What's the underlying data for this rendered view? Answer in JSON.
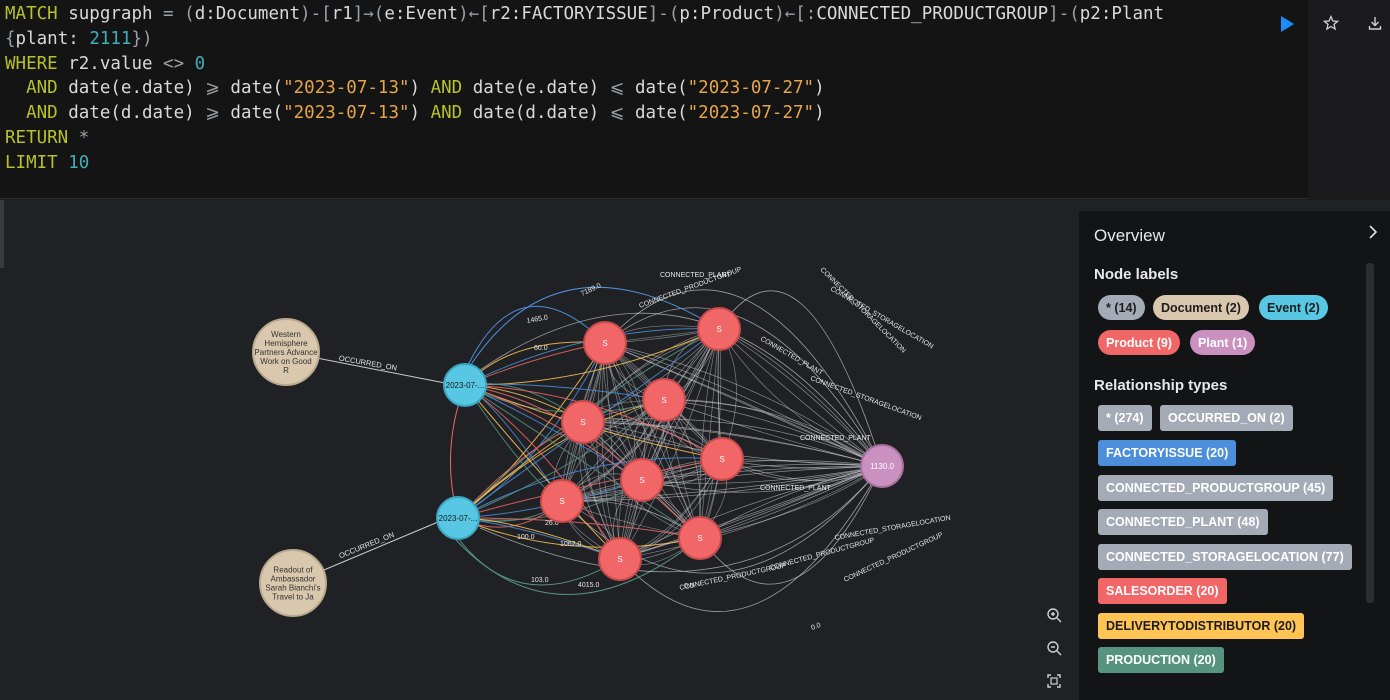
{
  "editor": {
    "lines": [
      [
        [
          "kw",
          "MATCH"
        ],
        [
          "t",
          " supgraph "
        ],
        [
          "op",
          "="
        ],
        [
          "t",
          " "
        ],
        [
          "op",
          "("
        ],
        [
          "t",
          "d:Document"
        ],
        [
          "op",
          ")-["
        ],
        [
          "t",
          "r1"
        ],
        [
          "op",
          "]→("
        ],
        [
          "t",
          "e:Event"
        ],
        [
          "op",
          ")←["
        ],
        [
          "t",
          "r2:FACTORYISSUE"
        ],
        [
          "op",
          "]-("
        ],
        [
          "t",
          "p:Product"
        ],
        [
          "op",
          ")←[:"
        ],
        [
          "t",
          "CONNECTED_PRODUCTGROUP"
        ],
        [
          "op",
          "]-("
        ],
        [
          "t",
          "p2:Plant"
        ]
      ],
      [
        [
          "op",
          "{"
        ],
        [
          "t",
          "plant: "
        ],
        [
          "num",
          "2111"
        ],
        [
          "op",
          "})"
        ]
      ],
      [
        [
          "kw",
          "WHERE"
        ],
        [
          "t",
          " r2.value "
        ],
        [
          "op",
          "<>"
        ],
        [
          "t",
          " "
        ],
        [
          "num",
          "0"
        ]
      ],
      [
        [
          "t",
          "  "
        ],
        [
          "kw",
          "AND"
        ],
        [
          "t",
          " date(e.date) "
        ],
        [
          "op",
          "⩾"
        ],
        [
          "t",
          " date("
        ],
        [
          "str",
          "\"2023-07-13\""
        ],
        [
          "t",
          ") "
        ],
        [
          "kw",
          "AND"
        ],
        [
          "t",
          " date(e.date) "
        ],
        [
          "op",
          "⩽"
        ],
        [
          "t",
          " date("
        ],
        [
          "str",
          "\"2023-07-27\""
        ],
        [
          "t",
          ")"
        ]
      ],
      [
        [
          "t",
          "  "
        ],
        [
          "kw",
          "AND"
        ],
        [
          "t",
          " date(d.date) "
        ],
        [
          "op",
          "⩾"
        ],
        [
          "t",
          " date("
        ],
        [
          "str",
          "\"2023-07-13\""
        ],
        [
          "t",
          ") "
        ],
        [
          "kw",
          "AND"
        ],
        [
          "t",
          " date(d.date) "
        ],
        [
          "op",
          "⩽"
        ],
        [
          "t",
          " date("
        ],
        [
          "str",
          "\"2023-07-27\""
        ],
        [
          "t",
          ")"
        ]
      ],
      [
        [
          "kw",
          "RETURN"
        ],
        [
          "t",
          " "
        ],
        [
          "op",
          "*"
        ]
      ],
      [
        [
          "kw",
          "LIMIT"
        ],
        [
          "t",
          " "
        ],
        [
          "num",
          "10"
        ]
      ]
    ]
  },
  "toolbar": {
    "run_icon": "play-icon",
    "favorite_icon": "star-icon",
    "download_icon": "download-icon"
  },
  "graph": {
    "documents": [
      {
        "label": [
          "Western",
          "Hemisphere",
          "Partners Advance",
          "Work on Good",
          "R"
        ],
        "edge_label": "OCCURRED_ON"
      },
      {
        "label": [
          "Readout of",
          "Ambassador",
          "Sarah Bianchi's",
          "Travel to Ja"
        ],
        "edge_label": "OCCURRED_ON"
      }
    ],
    "events": [
      "2023-07-...",
      "2023-07-..."
    ],
    "product_label": "S",
    "plant_label": "1130.0",
    "edge_labels": [
      "CONNECTED_PLANT",
      "CONNECTED_STORAGELOCATION",
      "CONNECTED_PRODUCTGROUP",
      "CONNECTED_STORAGELOCATION",
      "CONNECTED_PLANT",
      "7189.0",
      "1465.0",
      "60.0",
      "100.0",
      "26.0",
      "1062.0",
      "103.0",
      "4015.0",
      "0.0",
      "0.0",
      "CONNECTED_PRODUCTGROUP",
      "CONNECTED_PLANT",
      "CONNECTED_STORAGELOCATION",
      "CONNECTED_PRODUCTGROUP",
      "CONNECTED_PRODUCTGROUP",
      "CONNECTED_PLANT",
      "CONNECTED_STORAGELOCATION"
    ]
  },
  "panel": {
    "title": "Overview",
    "node_labels_heading": "Node labels",
    "node_labels": [
      {
        "text": "* (14)",
        "color": "#a5abb6"
      },
      {
        "text": "Document (2)",
        "color": "#d9c8ae"
      },
      {
        "text": "Event (2)",
        "color": "#57c7e3"
      },
      {
        "text": "Product (9)",
        "color": "#f16667"
      },
      {
        "text": "Plant (1)",
        "color": "#c990c0"
      }
    ],
    "rel_types_heading": "Relationship types",
    "rel_types": [
      {
        "text": "* (274)",
        "color": "#a5abb6",
        "fg": "#ffffff"
      },
      {
        "text": "OCCURRED_ON (2)",
        "color": "#a5abb6",
        "fg": "#ffffff"
      },
      {
        "text": "FACTORYISSUE (20)",
        "color": "#4c8eda",
        "fg": "#ffffff"
      },
      {
        "text": "CONNECTED_PRODUCTGROUP (45)",
        "color": "#a5abb6",
        "fg": "#ffffff"
      },
      {
        "text": "CONNECTED_PLANT (48)",
        "color": "#a5abb6",
        "fg": "#ffffff"
      },
      {
        "text": "CONNECTED_STORAGELOCATION (77)",
        "color": "#a5abb6",
        "fg": "#ffffff"
      },
      {
        "text": "SALESORDER (20)",
        "color": "#f16667",
        "fg": "#ffffff"
      },
      {
        "text": "DELIVERYTODISTRIBUTOR (20)",
        "color": "#ffc454",
        "fg": "#1d1d1d"
      },
      {
        "text": "PRODUCTION (20)",
        "color": "#569480",
        "fg": "#ffffff"
      }
    ]
  },
  "colors": {
    "document": "#d9c8ae",
    "event": "#57c7e3",
    "product": "#f16667",
    "plant": "#c990c0"
  }
}
